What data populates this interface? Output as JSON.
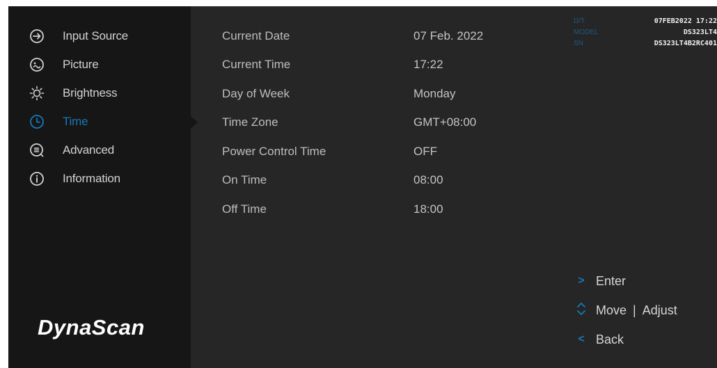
{
  "sidebar": {
    "items": [
      {
        "label": "Input Source",
        "icon": "input-source-icon"
      },
      {
        "label": "Picture",
        "icon": "picture-icon"
      },
      {
        "label": "Brightness",
        "icon": "brightness-icon"
      },
      {
        "label": "Time",
        "icon": "clock-icon",
        "active": true
      },
      {
        "label": "Advanced",
        "icon": "advanced-icon"
      },
      {
        "label": "Information",
        "icon": "info-icon"
      }
    ],
    "logo": "DynaScan"
  },
  "settings": [
    {
      "name": "Current Date",
      "value": "07 Feb. 2022"
    },
    {
      "name": "Current Time",
      "value": "17:22"
    },
    {
      "name": "Day of Week",
      "value": "Monday"
    },
    {
      "name": "Time Zone",
      "value": "GMT+08:00"
    },
    {
      "name": "Power Control Time",
      "value": "OFF"
    },
    {
      "name": "On Time",
      "value": "08:00"
    },
    {
      "name": "Off Time",
      "value": "18:00"
    }
  ],
  "device_info": [
    {
      "key": "D/T",
      "value": "07FEB2022 17:22"
    },
    {
      "key": "MODEL",
      "value": "DS323LT4"
    },
    {
      "key": "SN",
      "value": "DS323LT4B2RC401"
    }
  ],
  "help": {
    "enter": "Enter",
    "move": "Move",
    "separator": "|",
    "adjust": "Adjust",
    "back": "Back"
  },
  "colors": {
    "accent": "#1779ba",
    "sidebar_bg": "#161616",
    "panel_bg": "#262626"
  }
}
